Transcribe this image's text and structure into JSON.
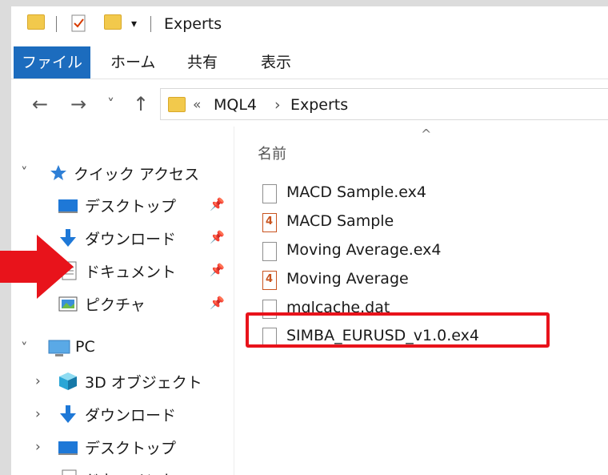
{
  "window": {
    "title": "Experts"
  },
  "ribbon": {
    "tabs": [
      {
        "label": "ファイル",
        "active": true
      },
      {
        "label": "ホーム"
      },
      {
        "label": "共有"
      },
      {
        "label": "表示"
      }
    ]
  },
  "nav": {
    "back_icon": "←",
    "forward_icon": "→",
    "recent_icon": "˅",
    "up_icon": "↑",
    "path": {
      "overflow": "«",
      "parts": [
        "MQL4",
        "Experts"
      ],
      "separator": "›"
    }
  },
  "sidebar": {
    "quick_access": {
      "label": "クイック アクセス",
      "icon": "star-icon"
    },
    "quick_items": [
      {
        "label": "デスクトップ",
        "icon": "desktop-icon",
        "pinned": true
      },
      {
        "label": "ダウンロード",
        "icon": "download-icon",
        "pinned": true
      },
      {
        "label": "ドキュメント",
        "icon": "document-icon",
        "pinned": true
      },
      {
        "label": "ピクチャ",
        "icon": "picture-icon",
        "pinned": true
      }
    ],
    "pc": {
      "label": "PC",
      "icon": "pc-icon"
    },
    "pc_items": [
      {
        "label": "3D オブジェクト",
        "icon": "cube-icon"
      },
      {
        "label": "ダウンロード",
        "icon": "download-icon"
      },
      {
        "label": "デスクトップ",
        "icon": "desktop-icon"
      },
      {
        "label": "ドキュメント",
        "icon": "document-icon"
      }
    ]
  },
  "content": {
    "column_header": "名前",
    "files": [
      {
        "name": "MACD Sample.ex4",
        "type": "ex4"
      },
      {
        "name": "MACD Sample",
        "type": "mq4"
      },
      {
        "name": "Moving Average.ex4",
        "type": "ex4"
      },
      {
        "name": "Moving Average",
        "type": "mq4"
      },
      {
        "name": "mqlcache.dat",
        "type": "dat"
      },
      {
        "name": "SIMBA_EURUSD_v1.0.ex4",
        "type": "ex4",
        "highlighted": true
      }
    ]
  },
  "annotations": {
    "arrow_color": "#e8131b",
    "highlight_color": "#e8131b"
  }
}
